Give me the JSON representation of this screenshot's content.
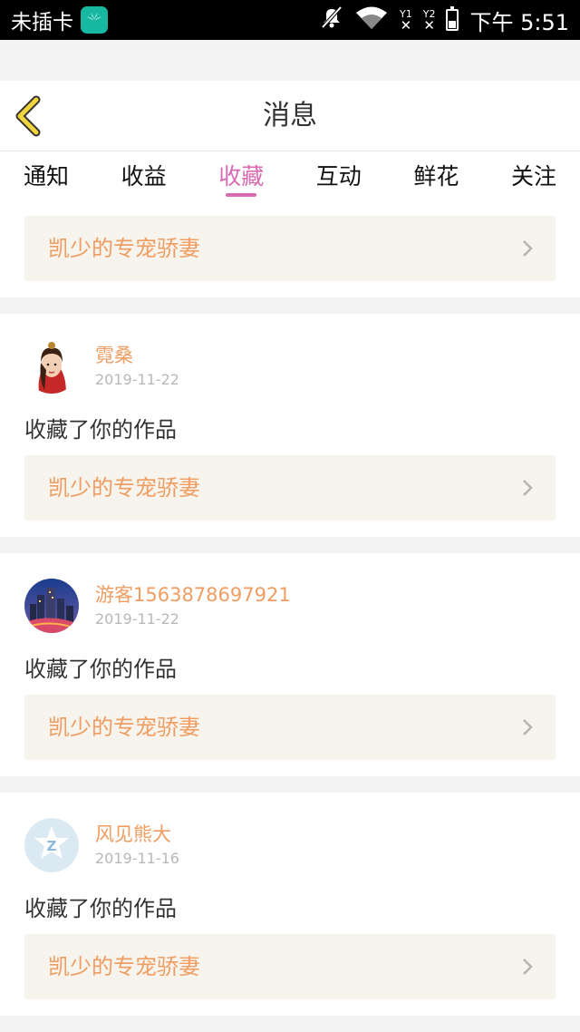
{
  "status_bar": {
    "carrier": "未插卡",
    "sim1": "1",
    "sim2": "2",
    "time": "下午 5:51",
    "battery_level": 0.4
  },
  "header": {
    "title": "消息",
    "back_icon": "chevron-left-icon"
  },
  "tabs": [
    {
      "label": "通知"
    },
    {
      "label": "收益"
    },
    {
      "label": "收藏"
    },
    {
      "label": "互动"
    },
    {
      "label": "鲜花"
    },
    {
      "label": "关注"
    }
  ],
  "active_tab": "收藏",
  "colors": {
    "accent": "#d86bb2",
    "name": "#ef9d62",
    "work_bar_bg": "#f6f4ec",
    "back_icon": "#f2d53a"
  },
  "first_item": {
    "work_title": "凯少的专宠骄妻"
  },
  "items": [
    {
      "user": "霓桑",
      "date": "2019-11-22",
      "action": "收藏了你的作品",
      "work_title": "凯少的专宠骄妻",
      "avatar": "character-avatar"
    },
    {
      "user": "游客1563878697921",
      "date": "2019-11-22",
      "action": "收藏了你的作品",
      "work_title": "凯少的专宠骄妻",
      "avatar": "city-night-avatar"
    },
    {
      "user": "风见熊大",
      "date": "2019-11-16",
      "action": "收藏了你的作品",
      "work_title": "凯少的专宠骄妻",
      "avatar": "qq-logo-avatar"
    }
  ]
}
